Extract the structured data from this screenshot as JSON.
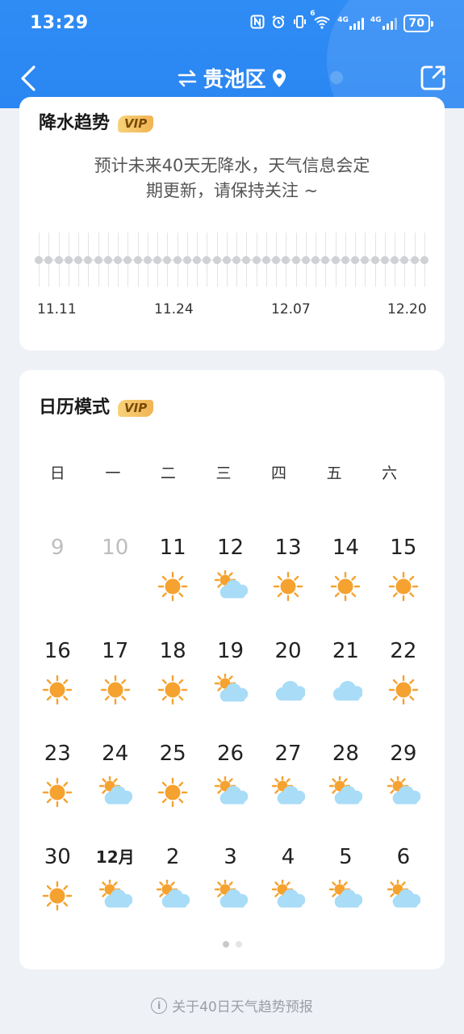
{
  "status_bar": {
    "time": "13:29",
    "battery": "70",
    "net1": "4G",
    "net2": "4G",
    "wifi_badge": "6"
  },
  "nav": {
    "title": "贵池区"
  },
  "precipitation": {
    "title": "降水趋势",
    "vip_badge": "VIP",
    "message_line1": "预计未来40天无降水，天气信息会定",
    "message_line2": "期更新，请保持关注 ~",
    "dates": [
      "11.11",
      "11.24",
      "12.07",
      "12.20"
    ],
    "day_count": 40
  },
  "calendar": {
    "title": "日历模式",
    "vip_badge": "VIP",
    "weekdays": [
      "日",
      "一",
      "二",
      "三",
      "四",
      "五",
      "六"
    ],
    "days": [
      {
        "label": "9",
        "weather": "",
        "dim": true
      },
      {
        "label": "10",
        "weather": "",
        "dim": true
      },
      {
        "label": "11",
        "weather": "sunny"
      },
      {
        "label": "12",
        "weather": "partly-cloudy"
      },
      {
        "label": "13",
        "weather": "sunny"
      },
      {
        "label": "14",
        "weather": "sunny"
      },
      {
        "label": "15",
        "weather": "sunny"
      },
      {
        "label": "16",
        "weather": "sunny"
      },
      {
        "label": "17",
        "weather": "sunny"
      },
      {
        "label": "18",
        "weather": "sunny"
      },
      {
        "label": "19",
        "weather": "partly-cloudy"
      },
      {
        "label": "20",
        "weather": "cloudy"
      },
      {
        "label": "21",
        "weather": "cloudy"
      },
      {
        "label": "22",
        "weather": "sunny"
      },
      {
        "label": "23",
        "weather": "sunny"
      },
      {
        "label": "24",
        "weather": "partly-cloudy"
      },
      {
        "label": "25",
        "weather": "sunny"
      },
      {
        "label": "26",
        "weather": "partly-cloudy"
      },
      {
        "label": "27",
        "weather": "partly-cloudy"
      },
      {
        "label": "28",
        "weather": "partly-cloudy"
      },
      {
        "label": "29",
        "weather": "partly-cloudy"
      },
      {
        "label": "30",
        "weather": "sunny"
      },
      {
        "label": "12月",
        "weather": "partly-cloudy",
        "month": true
      },
      {
        "label": "2",
        "weather": "partly-cloudy"
      },
      {
        "label": "3",
        "weather": "partly-cloudy"
      },
      {
        "label": "4",
        "weather": "partly-cloudy"
      },
      {
        "label": "5",
        "weather": "partly-cloudy"
      },
      {
        "label": "6",
        "weather": "partly-cloudy"
      }
    ]
  },
  "footer": {
    "link_text": "关于40日天气趋势预报"
  },
  "colors": {
    "header_blue": "#2a86f2",
    "sun_orange": "#f5a230",
    "cloud_blue": "#a9dcf7",
    "vip_gold": "#f1b453"
  }
}
